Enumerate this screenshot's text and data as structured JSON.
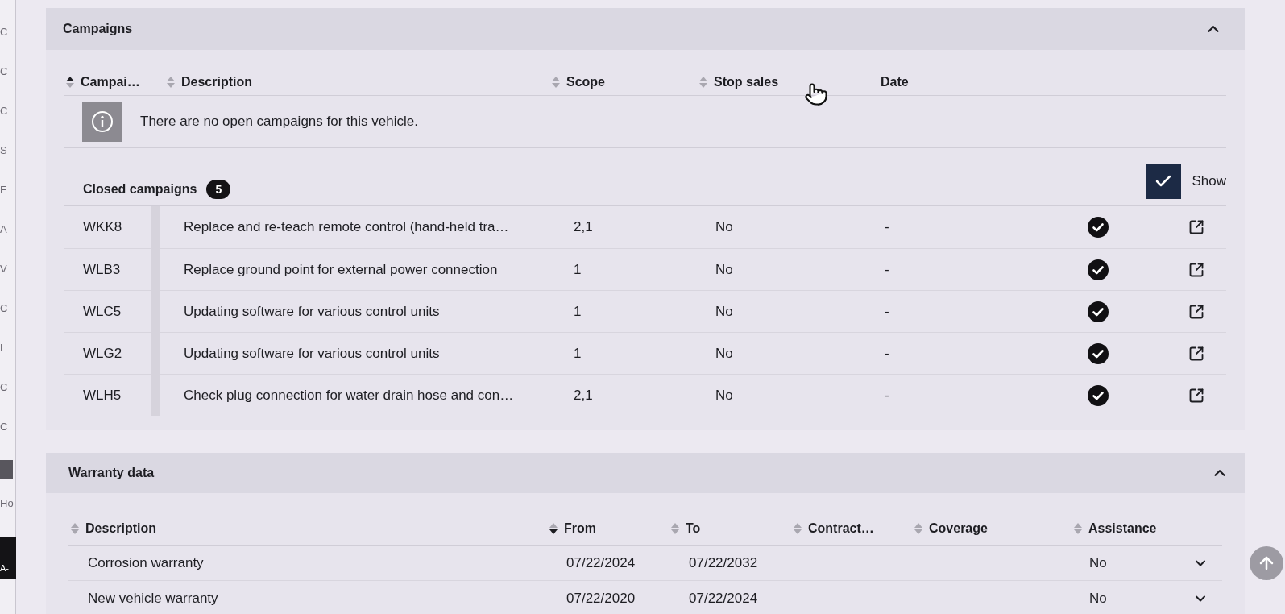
{
  "sidebar_edge": {
    "items": [
      {
        "kind": "letter",
        "text": "C"
      },
      {
        "kind": "letter",
        "text": "C"
      },
      {
        "kind": "letter",
        "text": "C"
      },
      {
        "kind": "letter",
        "text": "S"
      },
      {
        "kind": "letter",
        "text": "F"
      },
      {
        "kind": "letter",
        "text": "A"
      },
      {
        "kind": "letter",
        "text": "V"
      },
      {
        "kind": "letter",
        "text": "C"
      },
      {
        "kind": "letter",
        "text": "L"
      },
      {
        "kind": "letter",
        "text": "C"
      },
      {
        "kind": "letter",
        "text": "C"
      },
      {
        "kind": "tile"
      },
      {
        "kind": "letter",
        "text": "Ho"
      },
      {
        "kind": "tile",
        "text": "A-"
      }
    ]
  },
  "campaigns": {
    "title": "Campaigns",
    "expanded": true,
    "columns": [
      {
        "label": "Campai…",
        "sortable": true,
        "ascending": true,
        "descending": false
      },
      {
        "label": "Description",
        "sortable": true,
        "ascending": false,
        "descending": false
      },
      {
        "label": "Scope",
        "sortable": true,
        "ascending": false,
        "descending": false
      },
      {
        "label": "Stop sales",
        "sortable": true,
        "ascending": false,
        "descending": false
      },
      {
        "label": "Date",
        "sortable": false
      }
    ],
    "message": {
      "kind": "info",
      "text": "There are no open campaigns for this vehicle."
    },
    "closed": {
      "title": "Closed campaigns",
      "count": "5",
      "show": {
        "label": "Show",
        "checked": true
      },
      "rows": [
        {
          "code": "WKK8",
          "description": "Replace and re-teach remote control (hand-held tra…",
          "scope": "2,1",
          "stop_sales": "No",
          "date": "-",
          "completed": true
        },
        {
          "code": "WLB3",
          "description": "Replace ground point for external power connection",
          "scope": "1",
          "stop_sales": "No",
          "date": "-",
          "completed": true
        },
        {
          "code": "WLC5",
          "description": "Updating software for various control units",
          "scope": "1",
          "stop_sales": "No",
          "date": "-",
          "completed": true
        },
        {
          "code": "WLG2",
          "description": "Updating software for various control units",
          "scope": "1",
          "stop_sales": "No",
          "date": "-",
          "completed": true
        },
        {
          "code": "WLH5",
          "description": "Check plug connection for water drain hose and con…",
          "scope": "2,1",
          "stop_sales": "No",
          "date": "-",
          "completed": true
        }
      ]
    }
  },
  "warranty": {
    "title": "Warranty data",
    "expanded": true,
    "columns": [
      {
        "label": "Description",
        "sortable": true,
        "ascending": false,
        "descending": false
      },
      {
        "label": "From",
        "sortable": true,
        "ascending": false,
        "descending": true
      },
      {
        "label": "To",
        "sortable": true,
        "ascending": false,
        "descending": false
      },
      {
        "label": "Contract…",
        "sortable": true,
        "ascending": false,
        "descending": false
      },
      {
        "label": "Coverage",
        "sortable": true,
        "ascending": false,
        "descending": false
      },
      {
        "label": "Assistance",
        "sortable": true,
        "ascending": false,
        "descending": false
      }
    ],
    "rows": [
      {
        "description": "Corrosion warranty",
        "from": "07/22/2024",
        "to": "07/22/2032",
        "assistance": "No",
        "expanded": false
      },
      {
        "description": "New vehicle warranty",
        "from": "07/22/2020",
        "to": "07/22/2024",
        "assistance": "No",
        "expanded": false
      }
    ]
  }
}
